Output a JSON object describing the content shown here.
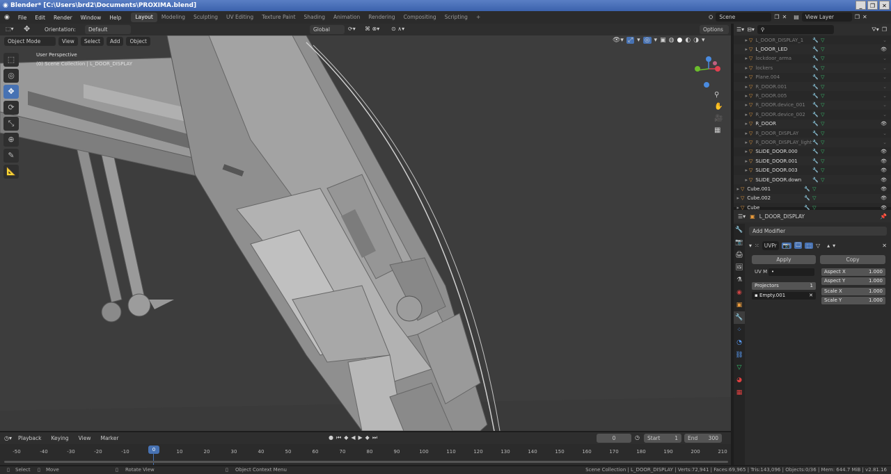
{
  "window": {
    "title": "Blender* [C:\\Users\\brd2\\Documents\\PROXIMA.blend]",
    "buttons": [
      "_",
      "❐",
      "✕"
    ]
  },
  "menu": {
    "items": [
      "File",
      "Edit",
      "Render",
      "Window",
      "Help"
    ]
  },
  "workspaces": {
    "tabs": [
      "Layout",
      "Modeling",
      "Sculpting",
      "UV Editing",
      "Texture Paint",
      "Shading",
      "Animation",
      "Rendering",
      "Compositing",
      "Scripting"
    ],
    "active": "Layout",
    "add": "+"
  },
  "scene": {
    "label": "Scene",
    "view_layer": "View Layer"
  },
  "tool_header": {
    "orientation_label": "Orientation:",
    "orientation_value": "Default",
    "transform": "Global",
    "options": "Options"
  },
  "viewport_header": {
    "mode": "Object Mode",
    "menus": [
      "View",
      "Select",
      "Add",
      "Object"
    ]
  },
  "viewport": {
    "perspective": "User Perspective",
    "collection": "(0) Scene Collection | L_DOOR_DISPLAY",
    "accent": "#4772b3"
  },
  "outliner": {
    "search_placeholder": "",
    "rows": [
      {
        "name": "L_DOOR_DISPLAY_1",
        "dim": true,
        "indent": 2
      },
      {
        "name": "L_DOOR_LED",
        "dim": false,
        "indent": 2
      },
      {
        "name": "lockdoor_arma",
        "dim": true,
        "indent": 2
      },
      {
        "name": "lockers",
        "dim": true,
        "indent": 2
      },
      {
        "name": "Plane.004",
        "dim": true,
        "indent": 2
      },
      {
        "name": "R_DOOR.001",
        "dim": true,
        "indent": 2
      },
      {
        "name": "R_DOOR.005",
        "dim": true,
        "indent": 2
      },
      {
        "name": "R_DOOR.device_001",
        "dim": true,
        "indent": 2
      },
      {
        "name": "R_DOOR.device_002",
        "dim": true,
        "indent": 2
      },
      {
        "name": "R_DOOR",
        "dim": false,
        "indent": 2
      },
      {
        "name": "R_DOOR_DISPLAY",
        "dim": true,
        "indent": 2
      },
      {
        "name": "R_DOOR_DISPLAY_light",
        "dim": true,
        "indent": 2
      },
      {
        "name": "SLIDE_DOOR.000",
        "dim": false,
        "indent": 2
      },
      {
        "name": "SLIDE_DOOR.001",
        "dim": false,
        "indent": 2
      },
      {
        "name": "SLIDE_DOOR.003",
        "dim": false,
        "indent": 2
      },
      {
        "name": "SLIDE_DOOR.down",
        "dim": false,
        "indent": 2
      },
      {
        "name": "Cube.001",
        "dim": false,
        "indent": 1
      },
      {
        "name": "Cube.002",
        "dim": false,
        "indent": 1
      },
      {
        "name": "Cube",
        "dim": false,
        "indent": 1
      }
    ]
  },
  "properties": {
    "object_name": "L_DOOR_DISPLAY",
    "add_modifier": "Add Modifier",
    "modifier_name": "UVPr",
    "apply": "Apply",
    "copy": "Copy",
    "uv_map_label": "UV M",
    "uv_map_value": "•",
    "aspect_x_label": "Aspect X",
    "aspect_x": "1.000",
    "aspect_y_label": "Aspect Y",
    "aspect_y": "1.000",
    "projectors_label": "Projectors",
    "projectors": "1",
    "scale_x_label": "Scale X",
    "scale_x": "1.000",
    "scale_y_label": "Scale Y",
    "scale_y": "1.000",
    "projector_object": "Empty.001"
  },
  "timeline": {
    "menus": [
      "Playback",
      "Keying",
      "View",
      "Marker"
    ],
    "current_frame": "0",
    "start_label": "Start",
    "start": "1",
    "end_label": "End",
    "end": "300",
    "ruler": [
      "-50",
      "-40",
      "-30",
      "-20",
      "-10",
      "0",
      "10",
      "20",
      "30",
      "40",
      "50",
      "60",
      "70",
      "80",
      "90",
      "100",
      "110",
      "120",
      "130",
      "140",
      "150",
      "160",
      "170",
      "180",
      "190",
      "200",
      "210"
    ],
    "playhead": "0"
  },
  "statusbar": {
    "select": "Select",
    "move": "Move",
    "rotate": "Rotate View",
    "context": "Object Context Menu",
    "stats": "Scene Collection | L_DOOR_DISPLAY | Verts:72,941 | Faces:69,965 | Tris:143,096 | Objects:0/36 | Mem: 644.7 MiB | v2.81.16"
  }
}
